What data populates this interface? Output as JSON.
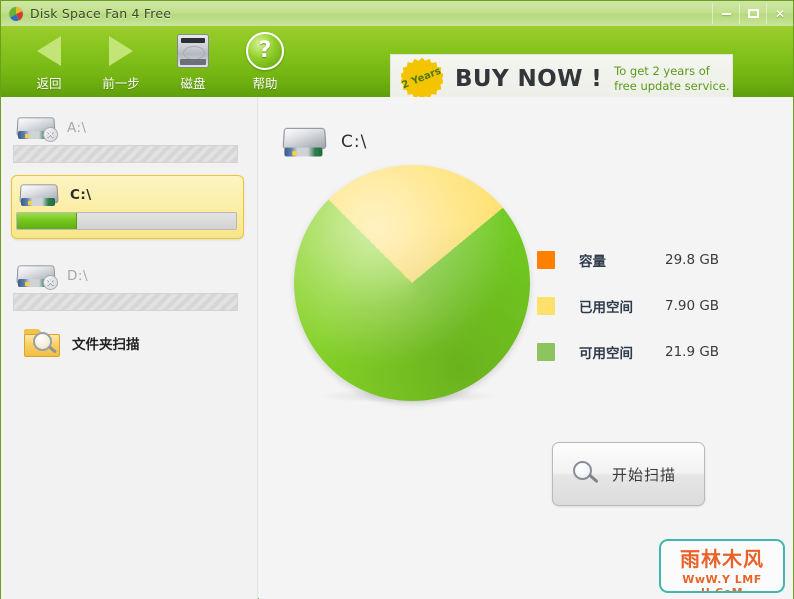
{
  "window": {
    "title": "Disk Space Fan 4 Free",
    "app_icon": "disk-fan-icon",
    "controls": {
      "minimize": "–",
      "maximize": "▢",
      "close": "✕"
    }
  },
  "toolbar": {
    "items": [
      {
        "label": "返回",
        "icon": "back-triangle-icon"
      },
      {
        "label": "前一步",
        "icon": "forward-triangle-icon"
      },
      {
        "label": "磁盘",
        "icon": "hard-disk-icon"
      },
      {
        "label": "帮助",
        "icon": "help-question-icon"
      }
    ]
  },
  "banner": {
    "badge_text": "2 Years",
    "headline": "BUY NOW !",
    "subtext_line1": "To get  2  years of",
    "subtext_line2": "free update service.",
    "badge_color": "#f5c400",
    "subtext_color": "#5a9a18"
  },
  "sidebar": {
    "drives": [
      {
        "label": "A:\\",
        "enabled": false,
        "used_percent": 0,
        "icon": "drive-disabled-icon"
      },
      {
        "label": "C:\\",
        "enabled": true,
        "selected": true,
        "used_percent": 27,
        "icon": "drive-icon"
      },
      {
        "label": "D:\\",
        "enabled": false,
        "used_percent": 0,
        "icon": "drive-disabled-icon"
      }
    ],
    "folder_scan": {
      "label": "文件夹扫描",
      "icon": "folder-search-icon"
    }
  },
  "main": {
    "header": {
      "drive_label": "C:\\",
      "icon": "drive-icon"
    },
    "scan_button": {
      "label": "开始扫描",
      "icon": "magnifier-icon"
    },
    "legend": [
      {
        "name": "容量",
        "value": "29.8 GB",
        "color": "#ff8000"
      },
      {
        "name": "已用空间",
        "value": "7.90 GB",
        "color": "#ffe06b"
      },
      {
        "name": "可用空间",
        "value": "21.9 GB",
        "color": "#8cc45e"
      }
    ]
  },
  "chart_data": {
    "type": "pie",
    "title": "C:\\",
    "labels": [
      "已用空间",
      "可用空间"
    ],
    "values": [
      7.9,
      21.9
    ],
    "unit": "GB",
    "total": 29.8,
    "total_label": "容量",
    "percentages": [
      26.5,
      73.5
    ],
    "colors": [
      "#ffe06b",
      "#6ec81e"
    ],
    "start_angle_deg": -45,
    "legend_position": "right",
    "grid": false
  },
  "watermark": {
    "title": "雨林木风",
    "url": "WwW.Y LMF U.CoM",
    "border_color": "#3fb7ad"
  }
}
